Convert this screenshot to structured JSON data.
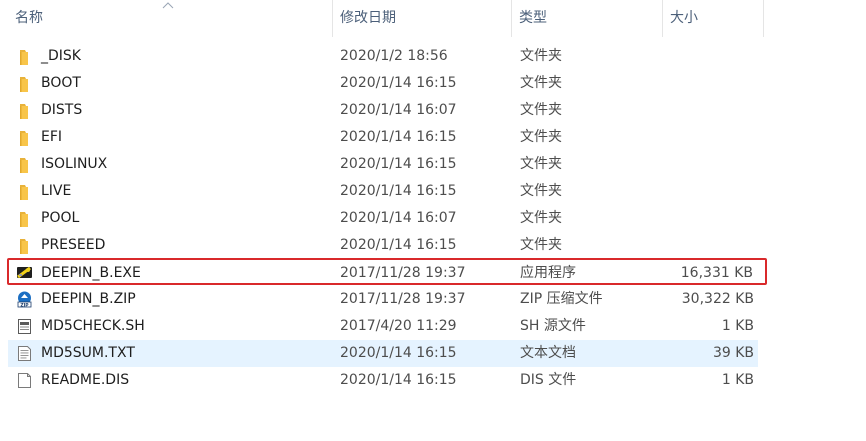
{
  "columns": {
    "name": "名称",
    "date": "修改日期",
    "type": "类型",
    "size": "大小"
  },
  "files": [
    {
      "name": "_DISK",
      "date": "2020/1/2 18:56",
      "type": "文件夹",
      "size": "",
      "icon": "folder-icon"
    },
    {
      "name": "BOOT",
      "date": "2020/1/14 16:15",
      "type": "文件夹",
      "size": "",
      "icon": "folder-icon"
    },
    {
      "name": "DISTS",
      "date": "2020/1/14 16:07",
      "type": "文件夹",
      "size": "",
      "icon": "folder-icon"
    },
    {
      "name": "EFI",
      "date": "2020/1/14 16:15",
      "type": "文件夹",
      "size": "",
      "icon": "folder-icon"
    },
    {
      "name": "ISOLINUX",
      "date": "2020/1/14 16:15",
      "type": "文件夹",
      "size": "",
      "icon": "folder-icon"
    },
    {
      "name": "LIVE",
      "date": "2020/1/14 16:15",
      "type": "文件夹",
      "size": "",
      "icon": "folder-icon"
    },
    {
      "name": "POOL",
      "date": "2020/1/14 16:07",
      "type": "文件夹",
      "size": "",
      "icon": "folder-icon"
    },
    {
      "name": "PRESEED",
      "date": "2020/1/14 16:15",
      "type": "文件夹",
      "size": "",
      "icon": "folder-icon"
    },
    {
      "name": "DEEPIN_B.EXE",
      "date": "2017/11/28 19:37",
      "type": "应用程序",
      "size": "16,331 KB",
      "icon": "exe-icon"
    },
    {
      "name": "DEEPIN_B.ZIP",
      "date": "2017/11/28 19:37",
      "type": "ZIP 压缩文件",
      "size": "30,322 KB",
      "icon": "zip-icon"
    },
    {
      "name": "MD5CHECK.SH",
      "date": "2017/4/20 11:29",
      "type": "SH 源文件",
      "size": "1 KB",
      "icon": "script-file-icon"
    },
    {
      "name": "MD5SUM.TXT",
      "date": "2020/1/14 16:15",
      "type": "文本文档",
      "size": "39 KB",
      "icon": "text-file-icon"
    },
    {
      "name": "README.DIS",
      "date": "2020/1/14 16:15",
      "type": "DIS 文件",
      "size": "1 KB",
      "icon": "blank-file-icon"
    }
  ],
  "highlighted_row": "DEEPIN_B.EXE",
  "hovered_row": "MD5SUM.TXT",
  "colors": {
    "header_text": "#4c607a",
    "highlight_outline": "#d9292b",
    "hover_bg": "#e5f3ff",
    "folder": "#f8c54a"
  }
}
